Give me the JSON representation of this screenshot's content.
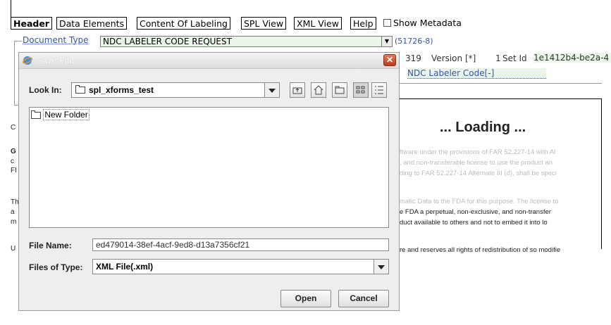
{
  "nav": {
    "tabs": [
      "Header",
      "Data Elements",
      "Content Of Labeling",
      "SPL View",
      "XML View",
      "Help"
    ],
    "show_metadata_label": "Show Metadata"
  },
  "document": {
    "type_label": "Document Type",
    "type_value": "NDC LABELER CODE REQUEST",
    "type_code": "(51726-8)",
    "id_fragment": "319",
    "version_label": "Version [*]",
    "version_value": "1",
    "set_id_label": "Set Id",
    "set_id_value": "1e1412b4-be2a-4",
    "ndc_labeler_code": "NDC Labeler Code[-]"
  },
  "loading": {
    "text": "... Loading ...",
    "line1": "ftware under the provisions of FAR 52.227-14 with Al",
    "line2": ", and non-transferable license to use the product an",
    "line3": "ding to FAR 52.227-14 Alternate III (d), shall be speci",
    "line4": "matic Data to the FDA for this purpose. The license to",
    "line5": "e FDA a perpetual, non-exclusive, and non-transfer",
    "line6": "duct available to others and not to embed it into lo",
    "line7": "re and reserves all rights of redistribution of so modifie"
  },
  "edge_letters": [
    "C",
    "G",
    "c",
    "FI",
    "Th",
    "a",
    "m",
    "U"
  ],
  "dialog": {
    "title": "Save File",
    "look_in_label": "Look In:",
    "look_in_value": "spl_xforms_test",
    "files": [
      "New Folder"
    ],
    "file_name_label": "File Name:",
    "file_name_value": "ed479014-38ef-4acf-9ed8-d13a7356cf21",
    "files_of_type_label": "Files of Type:",
    "files_of_type_value": "XML File(.xml)",
    "open_label": "Open",
    "cancel_label": "Cancel"
  }
}
